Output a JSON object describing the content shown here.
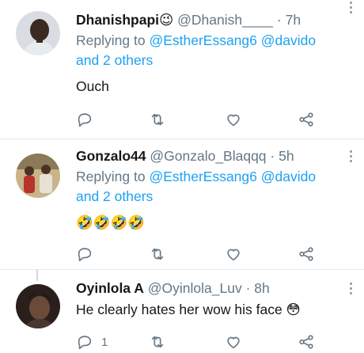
{
  "tweets": [
    {
      "name": "Dhanishpapi😉",
      "handle": "@Dhanish____",
      "separator": "·",
      "time": "7h",
      "replying_prefix": "Replying to",
      "replying_users": "@EstherEssang6 @davido",
      "replying_others": "and 2 others",
      "text": "Ouch",
      "reply_count": "",
      "icons": [
        "reply-icon",
        "retweet-icon",
        "like-icon",
        "share-icon"
      ]
    },
    {
      "name": "Gonzalo44",
      "handle": "@Gonzalo_Blaqqq",
      "separator": "·",
      "time": "5h",
      "replying_prefix": "Replying to",
      "replying_users": "@EstherEssang6 @davido",
      "replying_others": "and 2 others",
      "text": "🤣🤣🤣🤣",
      "reply_count": "",
      "icons": [
        "reply-icon",
        "retweet-icon",
        "like-icon",
        "share-icon"
      ]
    },
    {
      "name": "Oyinlola A",
      "handle": "@Oyinlola_Luv",
      "separator": "·",
      "time": "8h",
      "text": "He clearly hates her wow his face 😳",
      "reply_count": "1",
      "icons": [
        "reply-icon",
        "retweet-icon",
        "like-icon",
        "share-icon"
      ]
    }
  ],
  "colors": {
    "accent": "#1da1f2",
    "muted": "#657786",
    "divider": "#e1e8ed"
  }
}
